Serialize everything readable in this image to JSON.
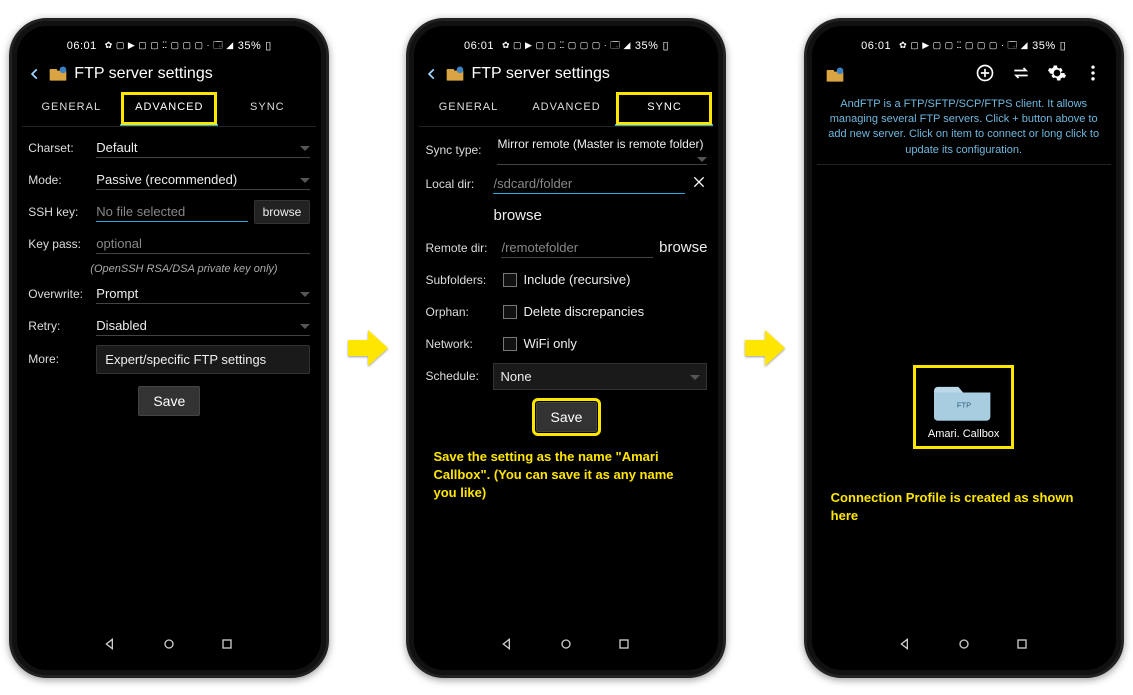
{
  "status": {
    "time": "06:01",
    "battery": "35%",
    "indicators": "✿ ▢ ▶ ▢ ▢ ⵆ ▢ ▢ ▢ ·   🗔 ◢"
  },
  "app": {
    "title": "FTP server settings"
  },
  "tabs": {
    "general": "GENERAL",
    "advanced": "ADVANCED",
    "sync": "SYNC"
  },
  "phone1": {
    "charset_label": "Charset:",
    "charset_value": "Default",
    "mode_label": "Mode:",
    "mode_value": "Passive (recommended)",
    "ssh_label": "SSH key:",
    "ssh_placeholder": "No file selected",
    "ssh_browse": "browse",
    "keypass_label": "Key pass:",
    "keypass_placeholder": "optional",
    "keypass_note": "(OpenSSH RSA/DSA private key only)",
    "overwrite_label": "Overwrite:",
    "overwrite_value": "Prompt",
    "retry_label": "Retry:",
    "retry_value": "Disabled",
    "more_label": "More:",
    "more_button": "Expert/specific FTP settings",
    "save": "Save"
  },
  "phone2": {
    "synctype_label": "Sync type:",
    "synctype_value": "Mirror remote (Master is remote folder)",
    "localdir_label": "Local dir:",
    "localdir_value": "/sdcard/folder",
    "browse_text": "browse",
    "remotedir_label": "Remote dir:",
    "remotedir_value": "/remotefolder",
    "subfolders_label": "Subfolders:",
    "subfolders_value": "Include (recursive)",
    "orphan_label": "Orphan:",
    "orphan_value": "Delete discrepancies",
    "network_label": "Network:",
    "network_value": "WiFi only",
    "schedule_label": "Schedule:",
    "schedule_value": "None",
    "save": "Save",
    "annotation": "Save the setting as the name \"Amari Callbox\". (You can save it as any name you like)"
  },
  "phone3": {
    "intro": "AndFTP is a FTP/SFTP/SCP/FTPS client. It allows managing several FTP servers. Click + button above to add new server. Click on item to connect or long click to update its configuration.",
    "profile_name": "Amari. Callbox",
    "folder_badge": "FTP",
    "annotation": "Connection Profile is created as shown here"
  }
}
